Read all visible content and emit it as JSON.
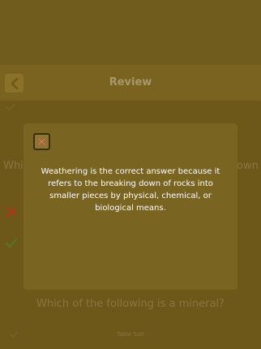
{
  "header": {
    "title": "Review",
    "back_icon": "chevron-left-icon"
  },
  "background": {
    "question_fragment_left": "Whi",
    "question_fragment_right": "own",
    "next_question": "Which of the following is a mineral?",
    "answer_option": "Table Salt",
    "correct_icon": "check-icon",
    "incorrect_icon": "x-icon",
    "colors": {
      "correct": "#4f7a22",
      "incorrect": "#a83a16"
    }
  },
  "dialog": {
    "close_icon": "close-icon",
    "explanation": "Weathering is the correct answer because it refers to the breaking down of rocks into smaller pieces by physical, chemical, or biological means."
  },
  "colors": {
    "scrim": "#6f5a1b",
    "dialog_bg": "#7a6421",
    "close_border": "#3a2e0c",
    "close_x": "#b8341a",
    "text": "#ffffff"
  }
}
